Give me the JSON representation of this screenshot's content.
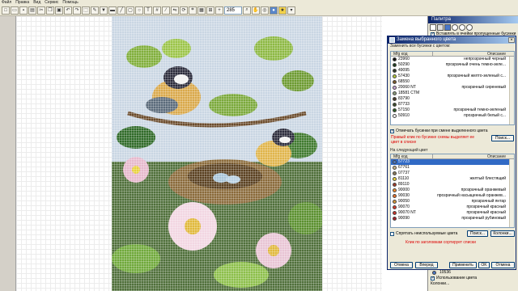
{
  "menu": [
    "Файл",
    "Правка",
    "Вид",
    "Сервис",
    "Помощь"
  ],
  "toolbar": {
    "zoom": "285"
  },
  "palette": {
    "title": "Палитра",
    "insert_label": "Вставлять в ячейки пропущенные бусинки",
    "bottom_items": [
      {
        "label": "10536"
      },
      {
        "label": "Использование цвета"
      },
      {
        "label": "Колонки..."
      }
    ]
  },
  "dialog": {
    "title": "Замена выбранного цвета",
    "replace_all_label": "Заменить все бусинки с цветом:",
    "columns": {
      "code": "Mfg код",
      "desc": "Описание"
    },
    "source_rows": [
      {
        "code": "23960",
        "desc": "непрозрачный черный",
        "color": "#111111"
      },
      {
        "code": "50290",
        "desc": "прозрачный очень темно-зеле...",
        "color": "#1e3b1c"
      },
      {
        "code": "49095",
        "desc": "",
        "color": "#2f3a2a"
      },
      {
        "code": "57430",
        "desc": "прозрачный желто-зеленый с...",
        "color": "#b5c93a"
      },
      {
        "code": "68550",
        "desc": "",
        "color": "#7a5a2a"
      },
      {
        "code": "20060 NT",
        "desc": "прозрачный сиреневый",
        "color": "#c9a8d8"
      },
      {
        "code": "18581 CTM",
        "desc": "",
        "color": "#8a9a7a"
      },
      {
        "code": "83790",
        "desc": "",
        "color": "#4a3a2a"
      },
      {
        "code": "87733",
        "desc": "",
        "color": "#3c4a2c"
      },
      {
        "code": "57150",
        "desc": "прозрачный темно-зеленый",
        "color": "#2a5a22"
      },
      {
        "code": "50910",
        "desc": "прозрачный белый с...",
        "color": "#f0f0f0"
      }
    ],
    "mark_label": "Отмечать бусинки при смене выделенного цвета",
    "search_label": "Поиск...",
    "hint": "Правый клик по бусинке схемы выделяет ее цвет в списке",
    "target_label": "На следующий цвет",
    "target_rows": [
      {
        "code": "57723",
        "desc": "",
        "color": "#4a78c8"
      },
      {
        "code": "67761",
        "desc": "",
        "color": "#c8b48a"
      },
      {
        "code": "07737",
        "desc": "",
        "color": "#8a7a5a"
      },
      {
        "code": "81110",
        "desc": "желтый блестящий",
        "color": "#e8d23a"
      },
      {
        "code": "89110",
        "desc": "",
        "color": "#a03a2a"
      },
      {
        "code": "90000",
        "desc": "прозрачный оранжевый",
        "color": "#f08a2a"
      },
      {
        "code": "90030",
        "desc": "прозрачный насыщенный оранжев...",
        "color": "#e8702a"
      },
      {
        "code": "90050",
        "desc": "прозрачный янтар",
        "color": "#d89a3a"
      },
      {
        "code": "90070",
        "desc": "прозрачный красный",
        "color": "#d83a2a"
      },
      {
        "code": "90070 NT",
        "desc": "прозрачный красный",
        "color": "#c8322a"
      },
      {
        "code": "90090",
        "desc": "прозрачный рубиновый",
        "color": "#a8202a"
      }
    ],
    "hide_unused_label": "Спрятать неиспользуемые цвета",
    "columns_btn": "Колонки...",
    "sort_hint": "Клик по заголовкам сортирует списки",
    "buttons": {
      "undo": "Отмена",
      "redo": "Вперед",
      "apply": "Применить",
      "ok": "OK",
      "close": "Отмена"
    }
  }
}
